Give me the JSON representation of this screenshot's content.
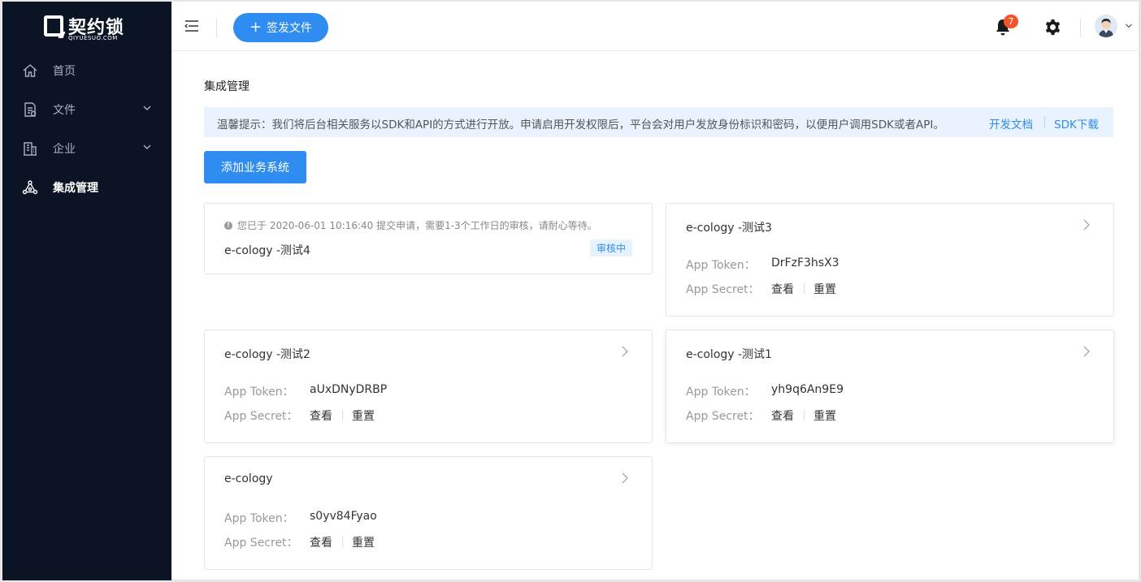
{
  "brand": {
    "name": "契约锁",
    "sub": "QIYUESUO.COM"
  },
  "sidebar": {
    "items": [
      {
        "label": "首页",
        "icon": "home-icon",
        "has_children": false,
        "active": false
      },
      {
        "label": "文件",
        "icon": "document-icon",
        "has_children": true,
        "active": false
      },
      {
        "label": "企业",
        "icon": "building-icon",
        "has_children": true,
        "active": false
      },
      {
        "label": "集成管理",
        "icon": "integration-icon",
        "has_children": false,
        "active": true
      }
    ]
  },
  "header": {
    "sign_button": "签发文件",
    "notification_count": "7"
  },
  "page": {
    "title": "集成管理",
    "notice": "温馨提示：我们将后台相关服务以SDK和API的方式进行开放。申请启用开发权限后，平台会对用户发放身份标识和密码，以便用户调用SDK或者API。",
    "doc_link": "开发文档",
    "sdk_link": "SDK下载",
    "add_button": "添加业务系统"
  },
  "labels": {
    "app_token": "App Token：",
    "app_secret": "App Secret：",
    "view": "查看",
    "reset": "重置"
  },
  "pending_card": {
    "info": "您已于 2020-06-01 10:16:40 提交申请，需要1-3个工作日的审核，请耐心等待。",
    "name": "e-cology -测试4",
    "status": "审核中"
  },
  "cards": [
    {
      "name": "e-cology -测试3",
      "token": "DrFzF3hsX3"
    },
    {
      "name": "e-cology -测试2",
      "token": "aUxDNyDRBP"
    },
    {
      "name": "e-cology -测试1",
      "token": "yh9q6An9E9"
    },
    {
      "name": "e-cology",
      "token": "s0yv84Fyao"
    }
  ],
  "colors": {
    "primary": "#2f8cf0",
    "sidebar_bg": "#0b1424",
    "notice_bg": "#e8f3fd",
    "badge": "#f2552c"
  }
}
